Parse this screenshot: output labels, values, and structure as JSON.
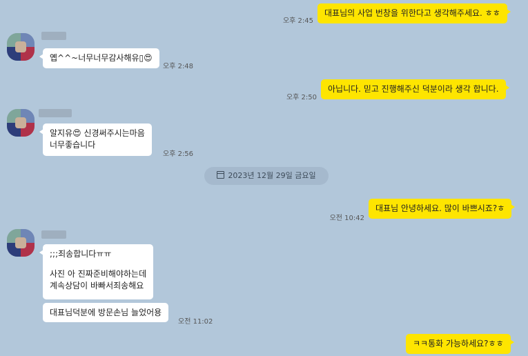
{
  "messages": {
    "m1": {
      "text": "대표님의 사업 번창을 위한다고 생각해주세요. ㅎㅎ",
      "time": "오후 2:45"
    },
    "m2": {
      "text": "옙^^~너무너무감사해유▯😍",
      "time": "오후 2:48"
    },
    "m3": {
      "text": "아닙니다. 믿고 진행해주신 덕분이라 생각 합니다.",
      "time": "오후 2:50"
    },
    "m4": {
      "line1": "알지유😍 신경써주시는마음",
      "line2": "너무좋습니다",
      "time": "오후 2:56"
    },
    "date_divider": "2023년 12월 29일 금요일",
    "m5": {
      "text": "대표님 안녕하세요. 많이 바쁘시죠?ㅎ",
      "time": "오전 10:42"
    },
    "m6": {
      "line1": ";;;죄송합니다ㅠㅠ",
      "line2": "사진 아 진짜준비해야하는데",
      "line3": "계속상담이 바빠서죄송해요"
    },
    "m7": {
      "text": "대표님덕분에 방문손님 늘었어용",
      "time": "오전 11:02"
    },
    "m8": {
      "text": "ㅋㅋ통화 가능하세요?ㅎㅎ"
    }
  },
  "icons": {
    "calendar": "calendar-icon",
    "avatar": "profile-avatar"
  },
  "colors": {
    "background": "#b2c7da",
    "my_bubble": "#fee500",
    "their_bubble": "#ffffff"
  }
}
